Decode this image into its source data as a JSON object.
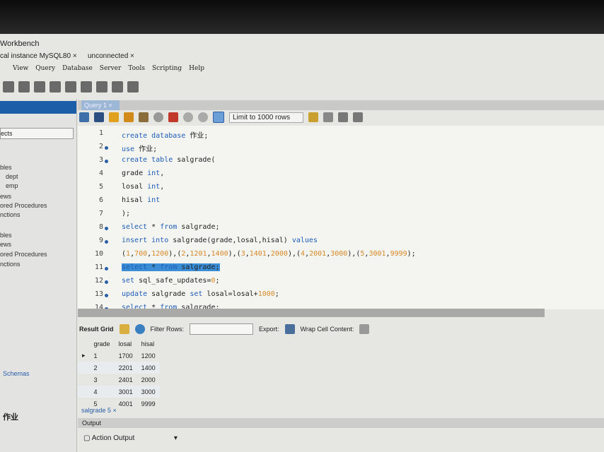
{
  "window": {
    "title": "Workbench"
  },
  "tabs": [
    {
      "label": "cal instance MySQL80"
    },
    {
      "label": "unconnected"
    }
  ],
  "menu": [
    "View",
    "Query",
    "Database",
    "Server",
    "Tools",
    "Scripting",
    "Help"
  ],
  "sidebar": {
    "search_placeholder": "ects",
    "items": [
      "bles",
      "dept",
      "emp",
      "ews",
      "ored Procedures",
      "nctions",
      "bles",
      "ews",
      "ored Procedures",
      "nctions"
    ],
    "schemas_tab": "Schemas",
    "db_name": "作业"
  },
  "query_tab": "Query 1",
  "editor_toolbar": {
    "limit": "Limit to 1000 rows"
  },
  "editor": {
    "lines": [
      {
        "n": "1",
        "dot": false,
        "html": "<span class='kw'>create database</span> 作业;"
      },
      {
        "n": "2",
        "dot": true,
        "html": "<span class='kw'>use</span> 作业;"
      },
      {
        "n": "3",
        "dot": true,
        "html": "<span class='kw'>create table</span> salgrade("
      },
      {
        "n": "4",
        "dot": false,
        "html": "grade <span class='kw'>int</span>,"
      },
      {
        "n": "5",
        "dot": false,
        "html": "losal <span class='kw'>int</span>,"
      },
      {
        "n": "6",
        "dot": false,
        "html": "hisal <span class='kw'>int</span>"
      },
      {
        "n": "7",
        "dot": false,
        "html": ");"
      },
      {
        "n": "8",
        "dot": true,
        "html": "<span class='kw'>select</span> * <span class='kw'>from</span> salgrade;"
      },
      {
        "n": "9",
        "dot": true,
        "html": "<span class='kw'>insert into</span> salgrade(grade,losal,hisal) <span class='kw'>values</span>"
      },
      {
        "n": "10",
        "dot": false,
        "html": "(<span class='num'>1</span>,<span class='num'>700</span>,<span class='num'>1200</span>),(<span class='num'>2</span>,<span class='num'>1201</span>,<span class='num'>1400</span>),(<span class='num'>3</span>,<span class='num'>1401</span>,<span class='num'>2000</span>),(<span class='num'>4</span>,<span class='num'>2001</span>,<span class='num'>3000</span>),(<span class='num'>5</span>,<span class='num'>3001</span>,<span class='num'>9999</span>);"
      },
      {
        "n": "11",
        "dot": true,
        "html": "<span class='sel'><span class='kw'>select</span> * <span class='kw'>from</span> salgrade;</span>"
      },
      {
        "n": "12",
        "dot": true,
        "html": "<span class='kw'>set</span> sql_safe_updates=<span class='num'>0</span>;"
      },
      {
        "n": "13",
        "dot": true,
        "html": "<span class='kw'>update</span> salgrade <span class='kw'>set</span> losal=losal+<span class='num'>1000</span>;"
      },
      {
        "n": "14",
        "dot": true,
        "html": "<span class='kw'>select</span> * <span class='kw'>from</span> salgrade;"
      }
    ]
  },
  "result": {
    "grid_label": "Result Grid",
    "filter_label": "Filter Rows:",
    "export_label": "Export:",
    "wrap_label": "Wrap Cell Content:",
    "columns": [
      "grade",
      "losal",
      "hisal"
    ],
    "rows": [
      [
        "1",
        "1700",
        "1200"
      ],
      [
        "2",
        "2201",
        "1400"
      ],
      [
        "3",
        "2401",
        "2000"
      ],
      [
        "4",
        "3001",
        "3000"
      ],
      [
        "5",
        "4001",
        "9999"
      ]
    ],
    "tab": "salgrade 5"
  },
  "output": {
    "header": "Output",
    "action": "Action Output"
  }
}
